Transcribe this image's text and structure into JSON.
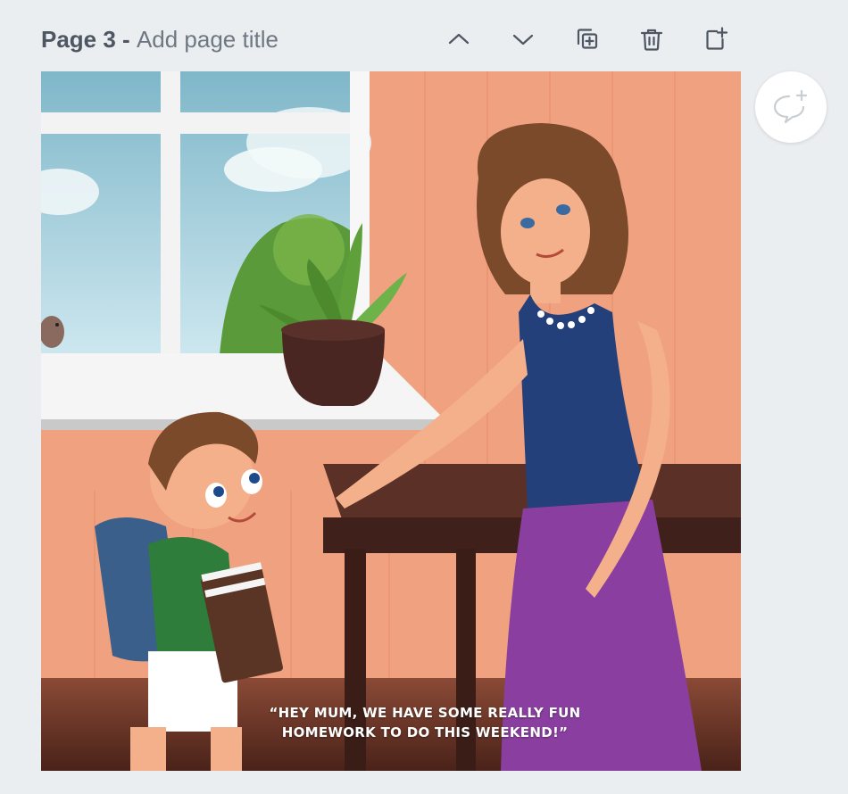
{
  "header": {
    "page_number": "Page 3",
    "separator": " - ",
    "page_title_placeholder": "Add page title"
  },
  "toolbar": {
    "move_up": "chevron-up-icon",
    "move_down": "chevron-down-icon",
    "duplicate": "duplicate-page-icon",
    "delete": "trash-icon",
    "add_page": "add-page-icon"
  },
  "canvas": {
    "caption_line1": "“HEY MUM, WE HAVE SOME REALLY FUN",
    "caption_line2": "HOMEWORK TO DO THIS WEEKEND!”"
  },
  "comment": {
    "icon": "add-comment-icon"
  },
  "colors": {
    "background": "#ebeef1",
    "icon": "#4d5661",
    "wall": "#f0a280",
    "floor": "#6b3a2e"
  }
}
